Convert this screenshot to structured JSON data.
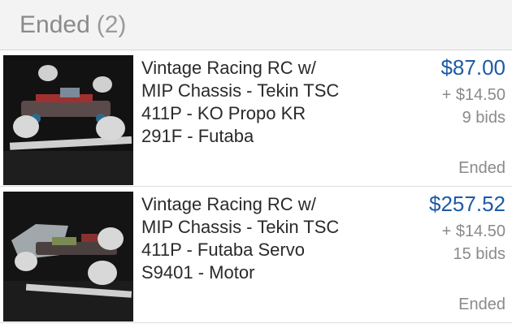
{
  "section": {
    "title": "Ended",
    "count": "(2)"
  },
  "listings": [
    {
      "title_lines": [
        "Vintage Racing RC w/",
        "MIP Chassis - Tekin TSC",
        "411P - KO Propo KR",
        "291F - Futaba"
      ],
      "price": "$87.00",
      "shipping": "+ $14.50",
      "bids": "9 bids",
      "status": "Ended",
      "thumbnail_icon": "rc-truck-photo"
    },
    {
      "title_lines": [
        "Vintage Racing RC w/",
        "MIP Chassis - Tekin TSC",
        "411P -  Futaba Servo",
        "S9401 - Motor"
      ],
      "price": "$257.52",
      "shipping": "+ $14.50",
      "bids": "15 bids",
      "status": "Ended",
      "thumbnail_icon": "rc-buggy-photo"
    }
  ],
  "colors": {
    "price": "#1d5aa6",
    "muted": "#8a8a8a",
    "header_bg": "#f3f3f3"
  }
}
